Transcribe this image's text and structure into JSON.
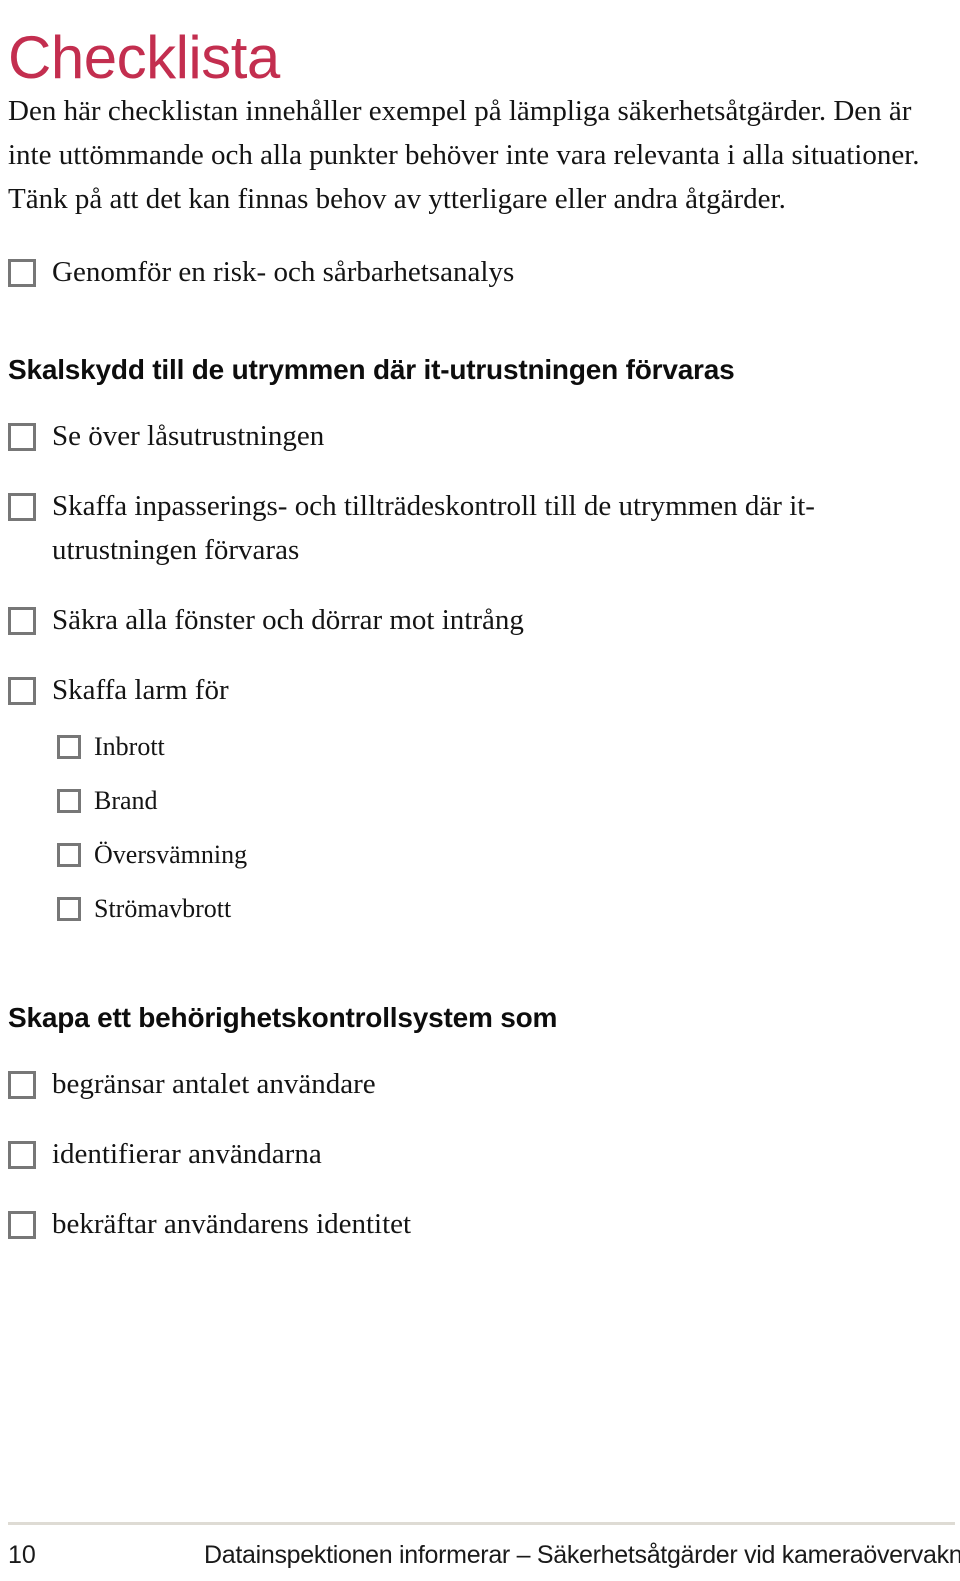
{
  "document": {
    "title": "Checklista",
    "title_color": "#c32e4f",
    "intro_paragraph": "Den här checklistan innehåller exempel på lämpliga säkerhetsåtgärder. Den är inte uttömmande och alla punkter behöver inte vara relevanta i alla situationer. Tänk på att det kan finnas behov av ytterligare eller andra åtgärder."
  },
  "checklist": {
    "intro_items": [
      {
        "label": "Genomför en risk- och sårbarhetsanalys",
        "checked": false,
        "icon": "checkbox-icon"
      }
    ],
    "sections": [
      {
        "heading": "Skalskydd till de utrymmen där it-utrustningen förvaras",
        "items": [
          {
            "label": "Se över låsutrustningen",
            "checked": false,
            "icon": "checkbox-icon",
            "level": 1
          },
          {
            "label": "Skaffa inpasserings- och tillträdeskontroll till de utrymmen där it-utrustningen förvaras",
            "checked": false,
            "icon": "checkbox-icon",
            "level": 1
          },
          {
            "label": "Säkra alla fönster och dörrar mot intrång",
            "checked": false,
            "icon": "checkbox-icon",
            "level": 1
          },
          {
            "label": "Skaffa larm för",
            "checked": false,
            "icon": "checkbox-icon",
            "level": 1
          },
          {
            "label": "Inbrott",
            "checked": false,
            "icon": "checkbox-icon",
            "level": 2
          },
          {
            "label": "Brand",
            "checked": false,
            "icon": "checkbox-icon",
            "level": 2
          },
          {
            "label": "Översvämning",
            "checked": false,
            "icon": "checkbox-icon",
            "level": 2
          },
          {
            "label": "Strömavbrott",
            "checked": false,
            "icon": "checkbox-icon",
            "level": 2
          }
        ]
      },
      {
        "heading": "Skapa ett behörighetskontrollsystem som",
        "items": [
          {
            "label": "begränsar antalet användare",
            "checked": false,
            "icon": "checkbox-icon",
            "level": 1
          },
          {
            "label": "identifierar användarna",
            "checked": false,
            "icon": "checkbox-icon",
            "level": 1
          },
          {
            "label": "bekräftar användarens identitet",
            "checked": false,
            "icon": "checkbox-icon",
            "level": 1
          }
        ]
      }
    ]
  },
  "footer": {
    "page_number": "10",
    "text": "Datainspektionen informerar – Säkerhetsåtgärder vid kameraövervakning",
    "rule_color": "#dedbd4"
  },
  "colors": {
    "title": "#c32e4f",
    "text": "#141414",
    "checkbox_border": "#777777",
    "footer_rule": "#dedbd4"
  }
}
